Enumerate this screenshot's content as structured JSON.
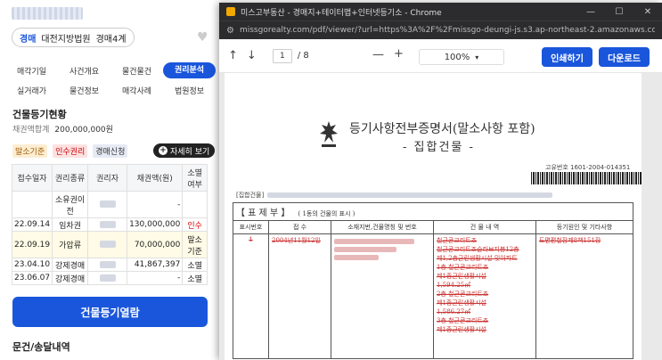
{
  "left_panel": {
    "court_chip": {
      "badge": "경매",
      "court": "대전지방법원",
      "division": "경매4계"
    },
    "tabs_row1": [
      "매각기일",
      "사건개요",
      "물건물건",
      "권리분석"
    ],
    "tabs_row2": [
      "실거래가",
      "물건정보",
      "매각사례",
      "법원정보"
    ],
    "section_title": "건물등기현황",
    "debt_label": "채권액합계",
    "debt_value": "200,000,000원",
    "badges": [
      "말소기준",
      "인수권리",
      "경매신청"
    ],
    "more_button": "자세히 보기",
    "table": {
      "headers": [
        "접수일자",
        "권리종류",
        "권리자",
        "채권액(원)",
        "소멸 여부"
      ],
      "rows": [
        {
          "date": "",
          "type": "소유권이전",
          "amount": "-",
          "status": ""
        },
        {
          "date": "22.09.14",
          "type": "임차권",
          "amount": "130,000,000",
          "status": "인수"
        },
        {
          "date": "22.09.19",
          "type": "가압류",
          "amount": "70,000,000",
          "status": "말소 기준"
        },
        {
          "date": "23.04.10",
          "type": "강제경매",
          "amount": "41,867,397",
          "status": "소멸"
        },
        {
          "date": "23.06.07",
          "type": "강제경매",
          "amount": "-",
          "status": "소멸"
        }
      ]
    },
    "view_button": "건물등기열람",
    "bottom_title": "문건/송달내역"
  },
  "chrome": {
    "window_title": "미스고부동산 - 경매지+테이터맵+인터넷등기소 - Chrome",
    "url": "missgorealty.com/pdf/viewer/?url=https%3A%2F%2Fmissgo-deungi-js.s3.ap-northeast-2.amazonaws.com%2F1601-...",
    "page_current": "1",
    "page_total": "/ 8",
    "zoom": "100%",
    "print_button": "인쇄하기",
    "download_button": "다운로드"
  },
  "document": {
    "title": "등기사항전부증명서(말소사항 포함)",
    "subtitle": "- 집합건물 -",
    "issue_no": "고유번호 1601-2004-014351",
    "building_label": "[집합건물]",
    "section_header": "【  표  제  부  】",
    "section_note": "( 1동의 건물의 표시 )",
    "columns": [
      "표시번호",
      "접  수",
      "소재지번,건물명칭 및 번호",
      "건 물 내 역",
      "등기원인 및 기타사항"
    ],
    "row": {
      "no": "1",
      "received": "2004년11월12일",
      "details": [
        "철근콘크리트조",
        "철근콘크리트조슬라브지붕12층",
        "제1,2층근린생활시설 및아파트",
        "1층 철근콘크리트조",
        "제1종근린생활시설",
        "1,594.25㎡",
        "2층 철근콘크리트조",
        "제1종근린생활시설",
        "1,586.27㎡",
        "3층 철근콘크리트조",
        "제1종근린생활시설"
      ],
      "cause": "도면편철장제8책151장"
    }
  }
}
